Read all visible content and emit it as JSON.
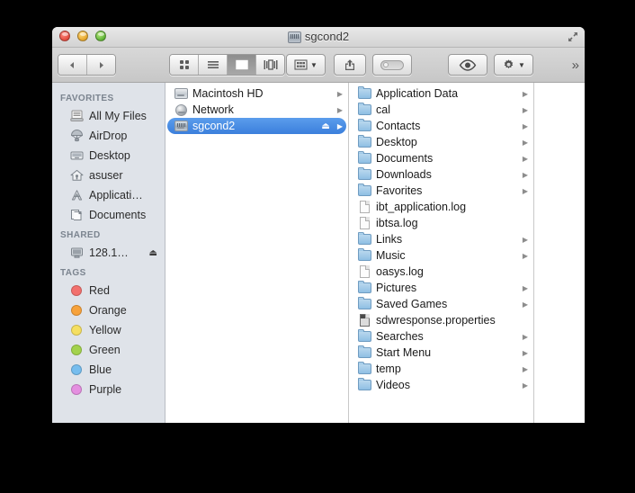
{
  "window": {
    "title": "sgcond2",
    "title_icon": "external-drive-icon",
    "traffic_lights": [
      "close-button",
      "minimize-button",
      "zoom-button"
    ],
    "fullscreen_icon": "fullscreen-arrows-icon"
  },
  "toolbar": {
    "back_label": "◀",
    "forward_label": "▶",
    "views": [
      {
        "name": "icon-view",
        "active": false
      },
      {
        "name": "list-view",
        "active": false
      },
      {
        "name": "column-view",
        "active": true
      },
      {
        "name": "cover-flow-view",
        "active": false
      }
    ],
    "arrange_icon": "arrange-grid-icon",
    "share_icon": "share-arrow-icon",
    "tag_icon": "tag-pill-icon",
    "quicklook_icon": "eye-icon",
    "action_icon": "gear-icon",
    "overflow_label": "»"
  },
  "sidebar": {
    "sections": [
      {
        "header": "FAVORITES",
        "items": [
          {
            "label": "All My Files",
            "icon": "all-my-files-icon"
          },
          {
            "label": "AirDrop",
            "icon": "airdrop-parachute-icon"
          },
          {
            "label": "Desktop",
            "icon": "desktop-monitor-icon"
          },
          {
            "label": "asuser",
            "icon": "home-house-icon"
          },
          {
            "label": "Applicati…",
            "icon": "applications-icon"
          },
          {
            "label": "Documents",
            "icon": "documents-icon"
          }
        ]
      },
      {
        "header": "SHARED",
        "items": [
          {
            "label": "128.1…",
            "icon": "network-server-icon",
            "eject": "⏏"
          }
        ]
      },
      {
        "header": "TAGS",
        "items": [
          {
            "label": "Red",
            "icon": "tag-dot-icon",
            "color": "#f2706d"
          },
          {
            "label": "Orange",
            "icon": "tag-dot-icon",
            "color": "#f7a23b"
          },
          {
            "label": "Yellow",
            "icon": "tag-dot-icon",
            "color": "#f5df61"
          },
          {
            "label": "Green",
            "icon": "tag-dot-icon",
            "color": "#a3d24c"
          },
          {
            "label": "Blue",
            "icon": "tag-dot-icon",
            "color": "#76bdee"
          },
          {
            "label": "Purple",
            "icon": "tag-dot-icon",
            "color": "#e48fe0"
          }
        ]
      }
    ]
  },
  "columns": [
    {
      "name": "column-volumes",
      "rows": [
        {
          "label": "Macintosh HD",
          "icon": "hard-drive-icon",
          "arrow": "▶",
          "selected": false
        },
        {
          "label": "Network",
          "icon": "network-globe-icon",
          "arrow": "▶",
          "selected": false
        },
        {
          "label": "sgcond2",
          "icon": "external-drive-icon",
          "arrow": "▶",
          "selected": true,
          "eject": "⏏"
        }
      ]
    },
    {
      "name": "column-sgcond2-contents",
      "rows": [
        {
          "label": "Application Data",
          "icon": "folder-icon",
          "arrow": "▶",
          "selected": false
        },
        {
          "label": "cal",
          "icon": "folder-icon",
          "arrow": "▶",
          "selected": false
        },
        {
          "label": "Contacts",
          "icon": "folder-icon",
          "arrow": "▶",
          "selected": false
        },
        {
          "label": "Desktop",
          "icon": "folder-icon",
          "arrow": "▶",
          "selected": false
        },
        {
          "label": "Documents",
          "icon": "folder-icon",
          "arrow": "▶",
          "selected": false
        },
        {
          "label": "Downloads",
          "icon": "folder-icon",
          "arrow": "▶",
          "selected": false
        },
        {
          "label": "Favorites",
          "icon": "folder-icon",
          "arrow": "▶",
          "selected": false
        },
        {
          "label": "ibt_application.log",
          "icon": "document-icon",
          "arrow": "",
          "selected": false
        },
        {
          "label": "ibtsa.log",
          "icon": "document-icon",
          "arrow": "",
          "selected": false
        },
        {
          "label": "Links",
          "icon": "folder-icon",
          "arrow": "▶",
          "selected": false
        },
        {
          "label": "Music",
          "icon": "folder-icon",
          "arrow": "▶",
          "selected": false
        },
        {
          "label": "oasys.log",
          "icon": "document-icon",
          "arrow": "",
          "selected": false
        },
        {
          "label": "Pictures",
          "icon": "folder-icon",
          "arrow": "▶",
          "selected": false
        },
        {
          "label": "Saved Games",
          "icon": "folder-icon",
          "arrow": "▶",
          "selected": false
        },
        {
          "label": "sdwresponse.properties",
          "icon": "properties-document-icon",
          "arrow": "",
          "selected": false
        },
        {
          "label": "Searches",
          "icon": "folder-icon",
          "arrow": "▶",
          "selected": false
        },
        {
          "label": "Start Menu",
          "icon": "folder-icon",
          "arrow": "▶",
          "selected": false
        },
        {
          "label": "temp",
          "icon": "folder-icon",
          "arrow": "▶",
          "selected": false
        },
        {
          "label": "Videos",
          "icon": "folder-icon",
          "arrow": "▶",
          "selected": false
        }
      ]
    },
    {
      "name": "column-empty-preview",
      "rows": []
    }
  ],
  "colors": {
    "selection_blue": "#3b7fdc",
    "sidebar_bg": "#dfe3e9",
    "toolbar_bg": "#cfcfcf"
  }
}
